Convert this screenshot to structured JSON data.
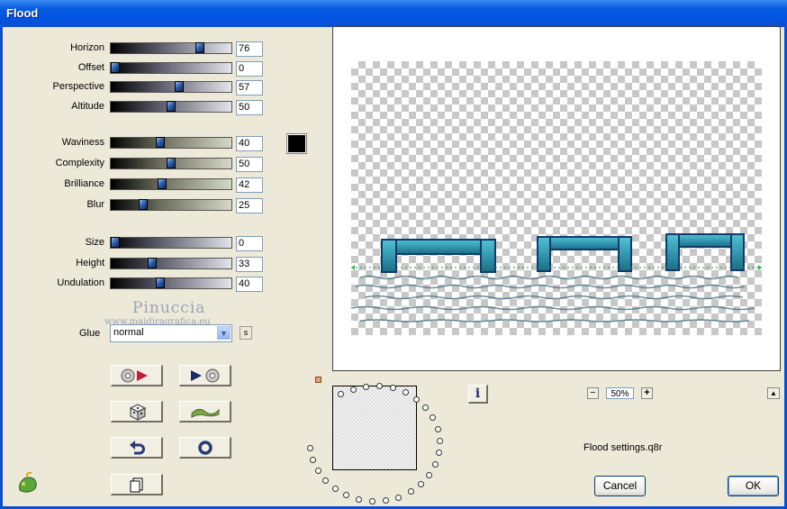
{
  "window": {
    "title": "Flood"
  },
  "sliders": [
    {
      "label": "Horizon",
      "value": "76",
      "fraction": 0.76
    },
    {
      "label": "Offset",
      "value": "0",
      "fraction": 0.0
    },
    {
      "label": "Perspective",
      "value": "57",
      "fraction": 0.57
    },
    {
      "label": "Altitude",
      "value": "50",
      "fraction": 0.5
    },
    {
      "label": "Waviness",
      "value": "40",
      "fraction": 0.4
    },
    {
      "label": "Complexity",
      "value": "50",
      "fraction": 0.5
    },
    {
      "label": "Brilliance",
      "value": "42",
      "fraction": 0.42
    },
    {
      "label": "Blur",
      "value": "25",
      "fraction": 0.25
    },
    {
      "label": "Size",
      "value": "0",
      "fraction": 0.0
    },
    {
      "label": "Height",
      "value": "33",
      "fraction": 0.33
    },
    {
      "label": "Undulation",
      "value": "40",
      "fraction": 0.4
    }
  ],
  "color_swatch": "#000000",
  "watermark": {
    "name": "Pinuccia",
    "site": "www.maidiragrafica.eu"
  },
  "glue": {
    "label": "Glue",
    "value": "normal",
    "s_button": "s"
  },
  "icon_buttons": [
    {
      "name": "randomize-left-icon"
    },
    {
      "name": "randomize-right-icon"
    },
    {
      "name": "dice-icon"
    },
    {
      "name": "wave-icon"
    },
    {
      "name": "undo-icon"
    },
    {
      "name": "reset-circle-icon"
    },
    {
      "name": "copy-icon"
    }
  ],
  "preview": {
    "zoom": "50%",
    "info_label": "i"
  },
  "settings_file": "Flood settings.q8r",
  "buttons": {
    "cancel": "Cancel",
    "ok": "OK"
  }
}
